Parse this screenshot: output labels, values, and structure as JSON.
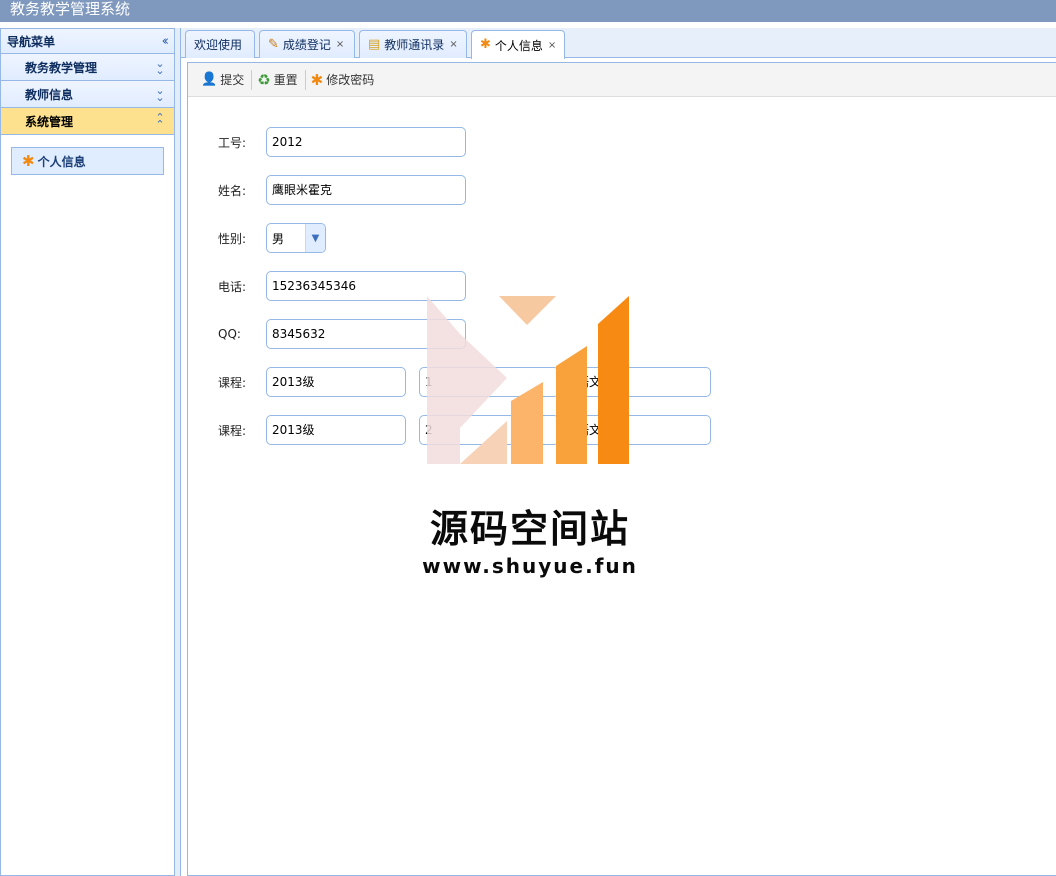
{
  "app": {
    "title": "教务教学管理系统"
  },
  "nav": {
    "header": "导航菜单",
    "items": [
      {
        "label": "教务教学管理",
        "expanded": false
      },
      {
        "label": "教师信息",
        "expanded": false
      },
      {
        "label": "系统管理",
        "expanded": true
      }
    ],
    "sub_items": [
      {
        "label": "个人信息",
        "icon": "star-icon"
      }
    ]
  },
  "tabs": [
    {
      "label": "欢迎使用",
      "closable": false
    },
    {
      "label": "成绩登记",
      "icon": "pencil-icon",
      "closable": true
    },
    {
      "label": "教师通讯录",
      "icon": "book-icon",
      "closable": true
    },
    {
      "label": "个人信息",
      "icon": "star-icon",
      "closable": true,
      "active": true
    }
  ],
  "toolbar": {
    "submit": "提交",
    "reset": "重置",
    "change_password": "修改密码"
  },
  "form": {
    "id_label": "工号:",
    "id_value": "2012",
    "name_label": "姓名:",
    "name_value": "鹰眼米霍克",
    "gender_label": "性别:",
    "gender_value": "男",
    "phone_label": "电话:",
    "phone_value": "15236345346",
    "qq_label": "QQ:",
    "qq_value": "8345632",
    "courses": [
      {
        "label": "课程:",
        "grade": "2013级",
        "class": "1",
        "subject": "语文"
      },
      {
        "label": "课程:",
        "grade": "2013级",
        "class": "2",
        "subject": "语文"
      }
    ]
  },
  "watermark": {
    "name": "源码空间站",
    "url": "www.shuyue.fun"
  },
  "colors": {
    "title_bar": "#7f99be",
    "border": "#95b8e7",
    "selected_menu": "#fde18e",
    "accent_orange": "#f08a13"
  }
}
